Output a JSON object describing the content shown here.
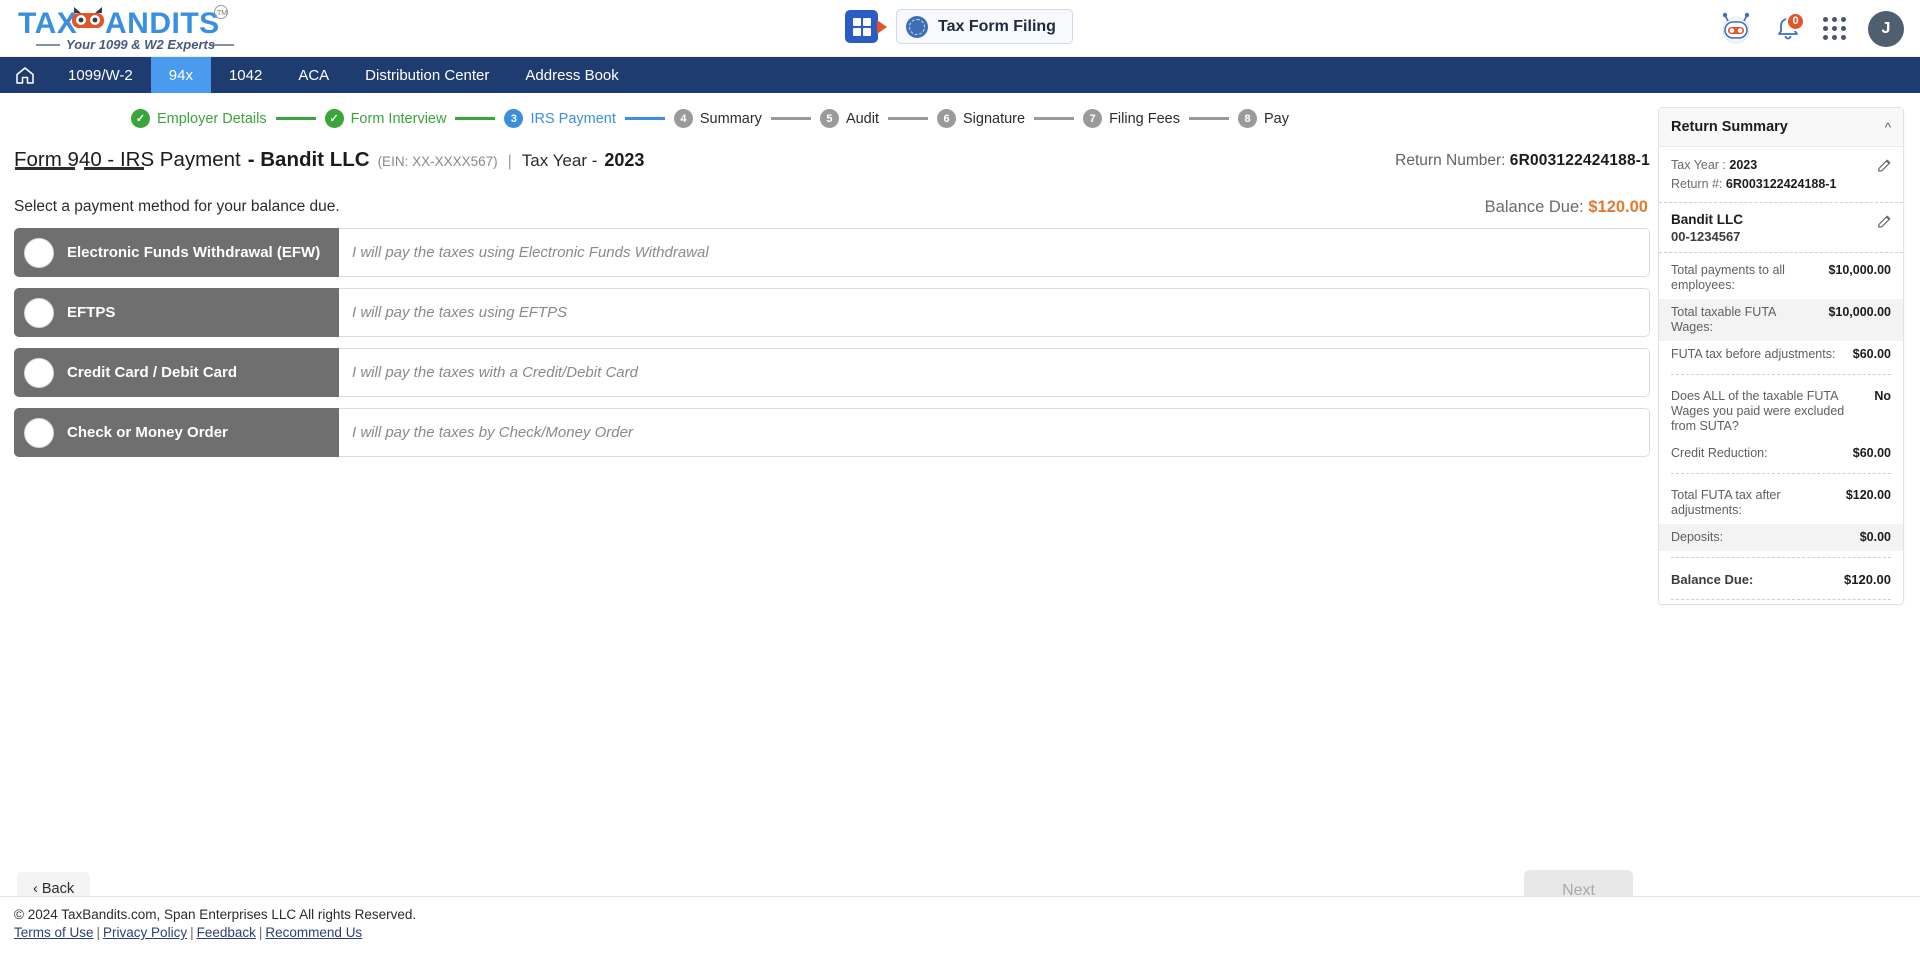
{
  "brand": {
    "name": "TAXBANDITS",
    "tagline": "Your 1099 & W2 Experts",
    "trademark": "TM",
    "colors": {
      "blue": "#3b8fe0",
      "orange": "#e0552a",
      "navy": "#1f3c70"
    }
  },
  "header": {
    "grid_badge_icon": "grid-badge-icon",
    "tax_form_filing_label": "Tax Form Filing",
    "seal_icon": "irs-seal-icon",
    "bot_icon": "bot-assistant-icon",
    "bell_icon": "notification-bell-icon",
    "notification_count": "0",
    "apps_icon": "apps-grid-icon",
    "avatar_initial": "J"
  },
  "nav": {
    "home_icon": "home-icon",
    "items": [
      {
        "label": "1099/W-2",
        "active": false
      },
      {
        "label": "94x",
        "active": true
      },
      {
        "label": "1042",
        "active": false
      },
      {
        "label": "ACA",
        "active": false
      },
      {
        "label": "Distribution Center",
        "active": false
      },
      {
        "label": "Address Book",
        "active": false
      }
    ]
  },
  "stepper": [
    {
      "num": "1",
      "label": "Employer Details",
      "state": "done"
    },
    {
      "num": "2",
      "label": "Form Interview",
      "state": "done"
    },
    {
      "num": "3",
      "label": "IRS Payment",
      "state": "cur"
    },
    {
      "num": "4",
      "label": "Summary",
      "state": "todo"
    },
    {
      "num": "5",
      "label": "Audit",
      "state": "todo"
    },
    {
      "num": "6",
      "label": "Signature",
      "state": "todo"
    },
    {
      "num": "7",
      "label": "Filing Fees",
      "state": "todo"
    },
    {
      "num": "8",
      "label": "Pay",
      "state": "todo"
    }
  ],
  "title": {
    "form": "Form 940 - IRS Payment",
    "company": "- Bandit LLC",
    "ein": "(EIN: XX-XXXX567)",
    "separator": "|",
    "tax_year_label": "Tax Year -",
    "tax_year_value": "2023"
  },
  "return_number": {
    "label": "Return Number:",
    "value": "6R003122424188-1"
  },
  "main": {
    "instruction": "Select a payment method for your balance due.",
    "balance_due_label": "Balance Due:",
    "balance_due_value": "$120.00",
    "payment_options": [
      {
        "label": "Electronic Funds Withdrawal (EFW)",
        "description": "I will pay the taxes using Electronic Funds Withdrawal",
        "selected": false
      },
      {
        "label": "EFTPS",
        "description": "I will pay the taxes using EFTPS",
        "selected": false
      },
      {
        "label": "Credit Card / Debit Card",
        "description": "I will pay the taxes with a Credit/Debit Card",
        "selected": false
      },
      {
        "label": "Check or Money Order",
        "description": "I will pay the taxes by Check/Money Order",
        "selected": false
      }
    ],
    "back_label": "Back",
    "next_label": "Next"
  },
  "summary": {
    "heading": "Return Summary",
    "collapse_icon": "chevron-up-icon",
    "edit_icon": "pencil-icon",
    "tax_year_label": "Tax Year :",
    "tax_year_value": "2023",
    "return_label": "Return #:",
    "return_value": "6R003122424188-1",
    "org_name": "Bandit LLC",
    "org_ein": "00-1234567",
    "rows": [
      {
        "key": "Total payments to all employees:",
        "value": "$10,000.00",
        "alt": false
      },
      {
        "key": "Total taxable FUTA Wages:",
        "value": "$10,000.00",
        "alt": true
      },
      {
        "key": "FUTA tax before adjustments:",
        "value": "$60.00",
        "alt": false
      }
    ],
    "rows2": [
      {
        "key": "Does ALL of the taxable FUTA Wages you paid were excluded from SUTA?",
        "value": "No",
        "alt": false
      },
      {
        "key": "Credit Reduction:",
        "value": "$60.00",
        "alt": false
      }
    ],
    "rows3": [
      {
        "key": "Total FUTA tax after adjustments:",
        "value": "$120.00",
        "alt": false
      },
      {
        "key": "Deposits:",
        "value": "$0.00",
        "alt": true
      }
    ],
    "total_row": {
      "key": "Balance Due:",
      "value": "$120.00"
    }
  },
  "footer": {
    "copyright": "© 2024 TaxBandits.com, Span Enterprises LLC All rights Reserved.",
    "links": [
      "Terms of Use",
      "Privacy Policy",
      "Feedback",
      "Recommend Us"
    ]
  }
}
